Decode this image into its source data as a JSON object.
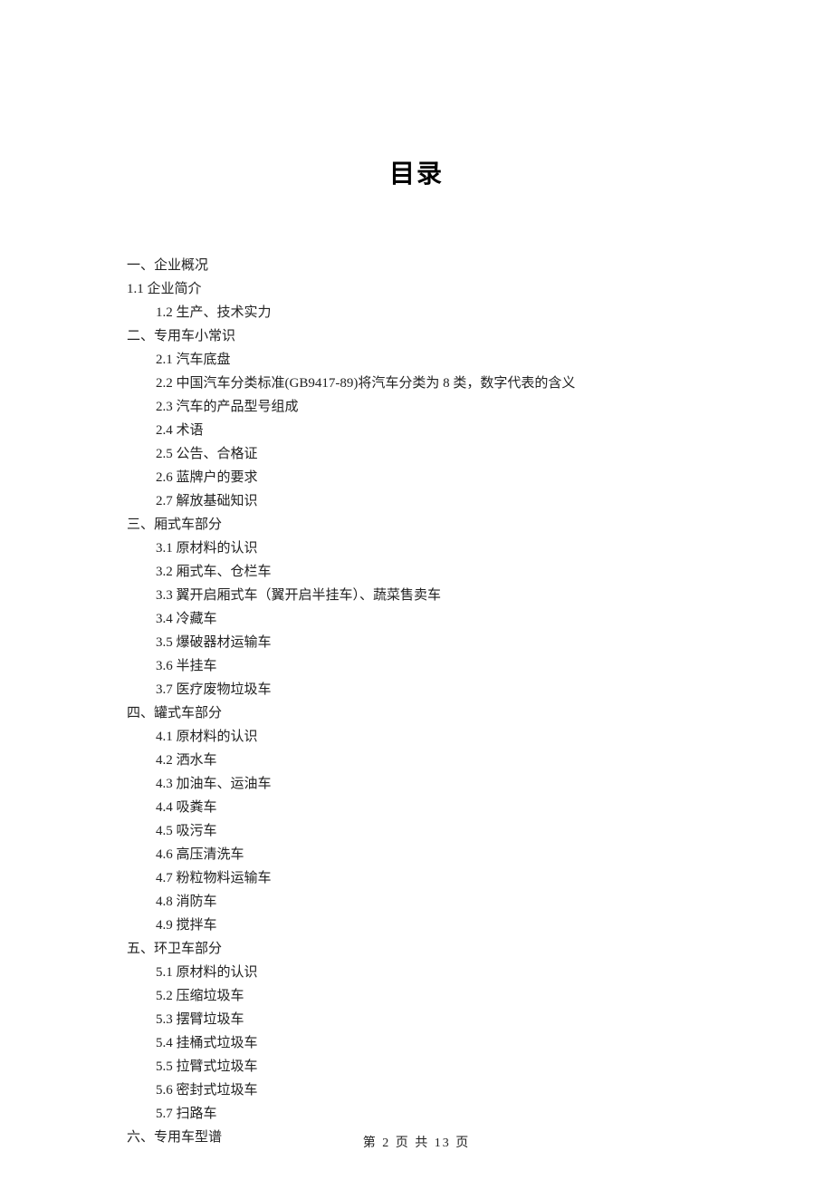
{
  "title": "目录",
  "footer": {
    "prefix": "第",
    "current": "2",
    "middle": "页 共",
    "total": "13",
    "suffix": "页"
  },
  "toc": [
    {
      "level": 0,
      "text": "一、企业概况"
    },
    {
      "level": 0,
      "text": "1.1 企业简介"
    },
    {
      "level": 1,
      "text": "1.2 生产、技术实力"
    },
    {
      "level": 0,
      "text": "二、专用车小常识"
    },
    {
      "level": 1,
      "text": "2.1 汽车底盘"
    },
    {
      "level": 1,
      "text": "2.2 中国汽车分类标准(GB9417-89)将汽车分类为 8 类，数字代表的含义"
    },
    {
      "level": 1,
      "text": "2.3 汽车的产品型号组成"
    },
    {
      "level": 1,
      "text": "2.4 术语"
    },
    {
      "level": 1,
      "text": "2.5 公告、合格证"
    },
    {
      "level": 1,
      "text": "2.6 蓝牌户的要求"
    },
    {
      "level": 1,
      "text": "2.7 解放基础知识"
    },
    {
      "level": 0,
      "text": "三、厢式车部分"
    },
    {
      "level": 1,
      "text": "3.1 原材料的认识"
    },
    {
      "level": 1,
      "text": "3.2 厢式车、仓栏车"
    },
    {
      "level": 1,
      "text": "3.3 翼开启厢式车（翼开启半挂车）、蔬菜售卖车"
    },
    {
      "level": 1,
      "text": "3.4 冷藏车"
    },
    {
      "level": 1,
      "text": "3.5 爆破器材运输车"
    },
    {
      "level": 1,
      "text": "3.6 半挂车"
    },
    {
      "level": 1,
      "text": "3.7 医疗废物垃圾车"
    },
    {
      "level": 0,
      "text": "四、罐式车部分"
    },
    {
      "level": 1,
      "text": "4.1 原材料的认识"
    },
    {
      "level": 1,
      "text": "4.2 洒水车"
    },
    {
      "level": 1,
      "text": "4.3 加油车、运油车"
    },
    {
      "level": 1,
      "text": "4.4 吸粪车"
    },
    {
      "level": 1,
      "text": "4.5 吸污车"
    },
    {
      "level": 1,
      "text": "4.6 高压清洗车"
    },
    {
      "level": 1,
      "text": "4.7 粉粒物料运输车"
    },
    {
      "level": 1,
      "text": "4.8 消防车"
    },
    {
      "level": 1,
      "text": "4.9 搅拌车"
    },
    {
      "level": 0,
      "text": "五、环卫车部分"
    },
    {
      "level": 1,
      "text": "5.1 原材料的认识"
    },
    {
      "level": 1,
      "text": "5.2 压缩垃圾车"
    },
    {
      "level": 1,
      "text": "5.3 摆臂垃圾车"
    },
    {
      "level": 1,
      "text": "5.4 挂桶式垃圾车"
    },
    {
      "level": 1,
      "text": "5.5 拉臂式垃圾车"
    },
    {
      "level": 1,
      "text": "5.6 密封式垃圾车"
    },
    {
      "level": 1,
      "text": "5.7 扫路车"
    },
    {
      "level": 0,
      "text": "六、专用车型谱"
    }
  ]
}
